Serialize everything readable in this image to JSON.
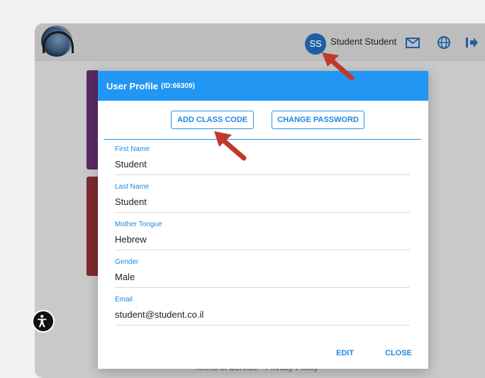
{
  "header": {
    "avatar_initials": "SS",
    "user_name": "Student Student",
    "icons": [
      "mail-icon",
      "globe-icon",
      "logout-icon"
    ]
  },
  "footer": {
    "text": "Terms of Service · Privacy Policy"
  },
  "modal": {
    "title": "User Profile",
    "id_text": "(ID:66309)",
    "add_class_code_label": "ADD CLASS CODE",
    "change_password_label": "CHANGE PASSWORD",
    "fields": [
      {
        "label": "First Name",
        "value": "Student"
      },
      {
        "label": "Last Name",
        "value": "Student"
      },
      {
        "label": "Mother Tongue",
        "value": "Hebrew"
      },
      {
        "label": "Gender",
        "value": "Male"
      },
      {
        "label": "Email",
        "value": "student@student.co.il"
      }
    ],
    "edit_label": "EDIT",
    "close_label": "CLOSE"
  },
  "colors": {
    "accent": "#2196f3",
    "avatar": "#1e5fa3",
    "annotation_arrow": "#c0392b"
  }
}
